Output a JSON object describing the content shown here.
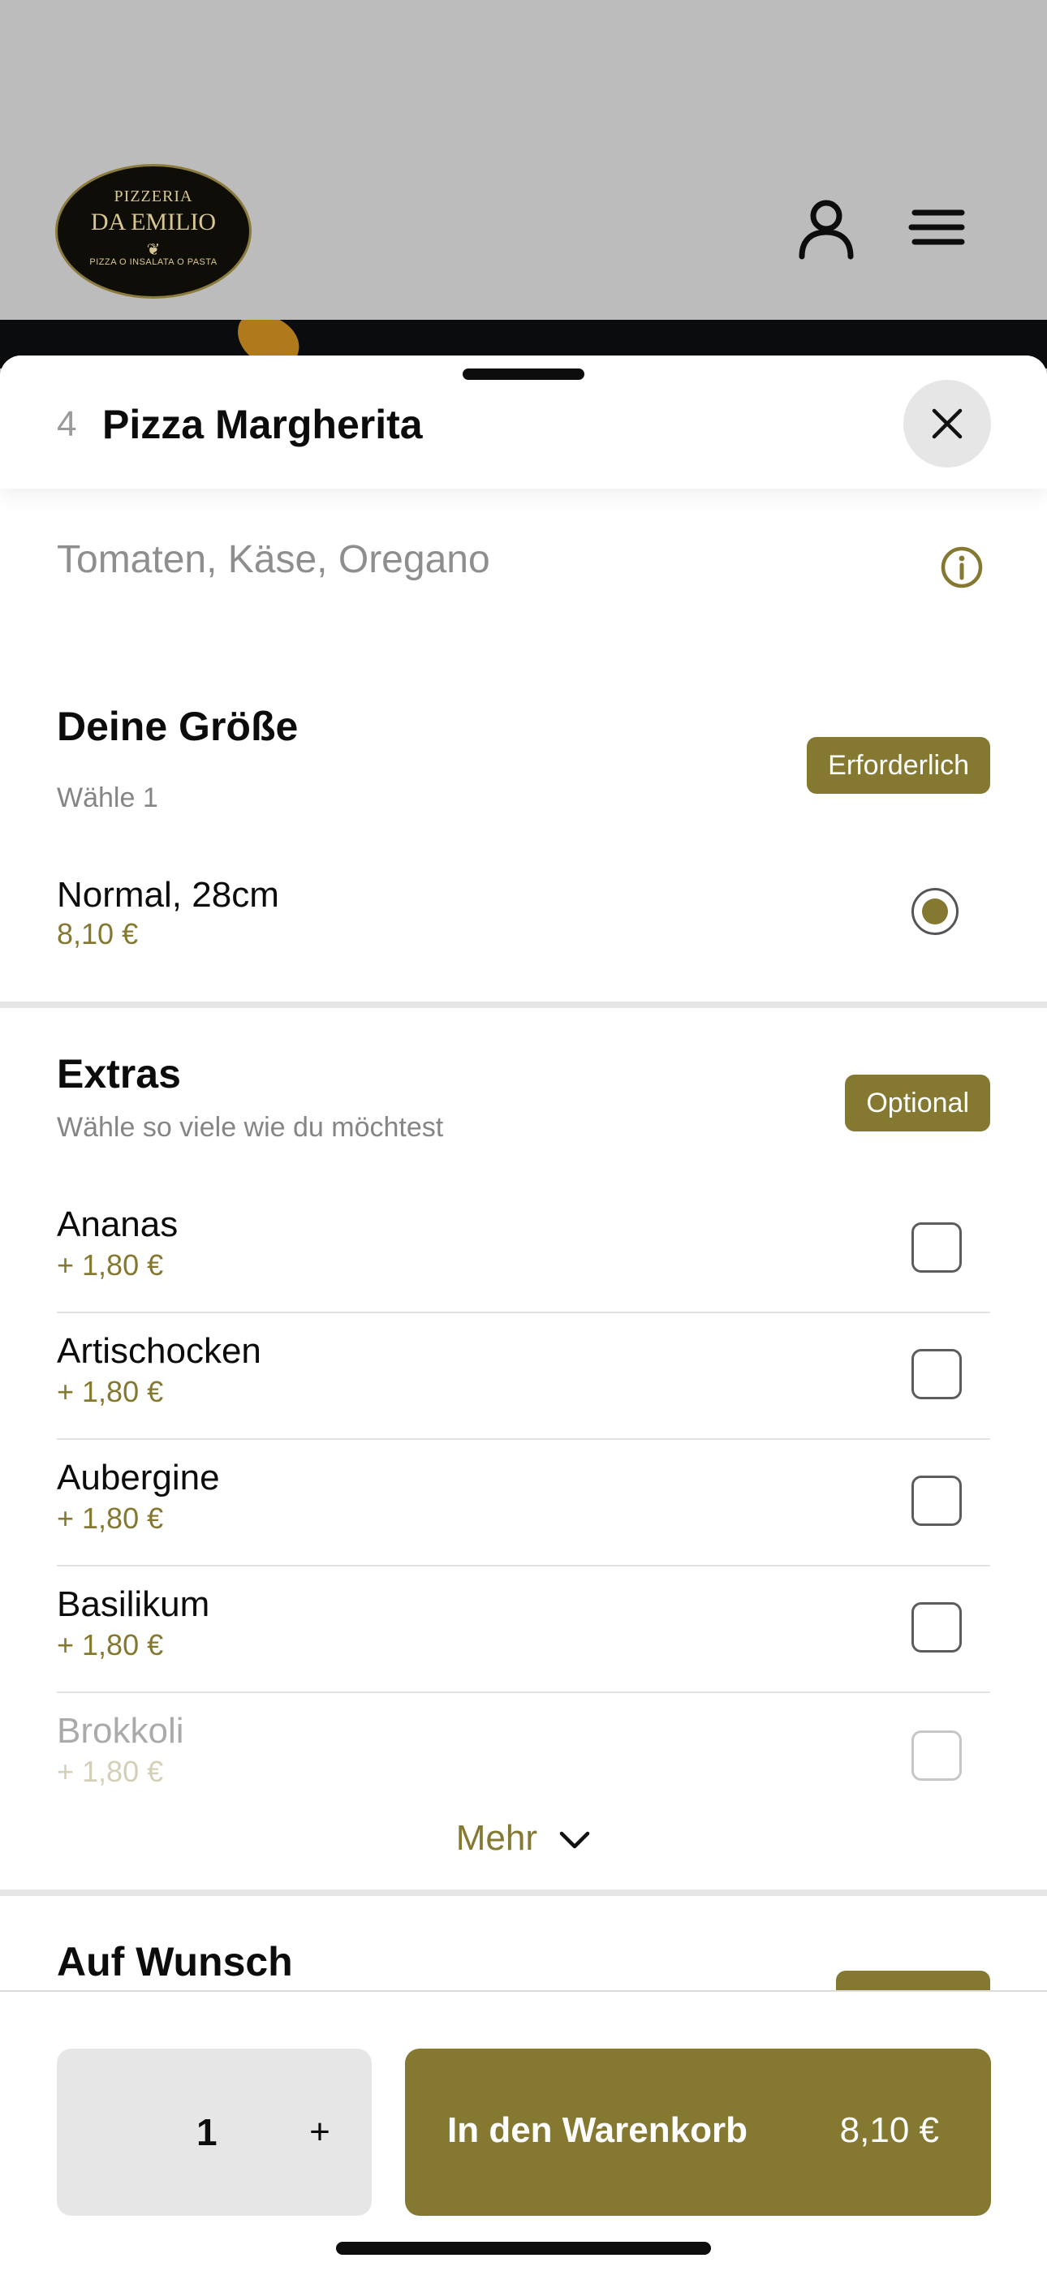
{
  "header": {
    "logo": {
      "line1": "PIZZERIA",
      "line2": "DA EMILIO",
      "line3": "PIZZA O INSALATA O PASTA"
    },
    "icons": [
      "user-icon",
      "menu-icon"
    ]
  },
  "product": {
    "number": "4",
    "title": "Pizza Margherita",
    "description": "Tomaten, Käse, Oregano"
  },
  "size_section": {
    "title": "Deine Größe",
    "subtitle": "Wähle 1",
    "badge": "Erforderlich",
    "options": [
      {
        "name": "Normal, 28cm",
        "price": "8,10 €",
        "selected": true
      }
    ]
  },
  "extras_section": {
    "title": "Extras",
    "subtitle": "Wähle so viele wie du möchtest",
    "badge": "Optional",
    "items": [
      {
        "name": "Ananas",
        "price": "+ 1,80 €",
        "checked": false
      },
      {
        "name": "Artischocken",
        "price": "+ 1,80 €",
        "checked": false
      },
      {
        "name": "Aubergine",
        "price": "+ 1,80 €",
        "checked": false
      },
      {
        "name": "Basilikum",
        "price": "+ 1,80 €",
        "checked": false
      },
      {
        "name": "Brokkoli",
        "price": "+ 1,80 €",
        "checked": false
      }
    ],
    "more_label": "Mehr"
  },
  "wish_section": {
    "title": "Auf Wunsch"
  },
  "footer": {
    "quantity": "1",
    "plus_label": "+",
    "add_to_cart_label": "In den Warenkorb",
    "total_price": "8,10 €"
  },
  "colors": {
    "accent": "#857932",
    "background_dim": "#bcbcbc",
    "close_bg": "#e6e6e6"
  }
}
